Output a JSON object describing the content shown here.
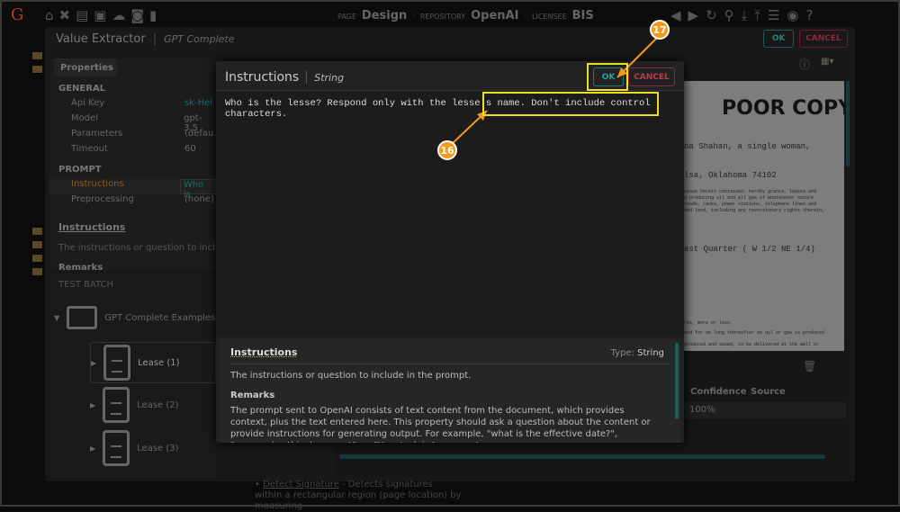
{
  "topbar": {
    "logo": "G",
    "page_label": "PAGE",
    "page": "Design",
    "repo_label": "REPOSITORY",
    "repo": "OpenAI",
    "licensee_label": "LICENSEE",
    "licensee": "BIS"
  },
  "panel": {
    "title": "Value Extractor",
    "subtitle": "GPT Complete",
    "ok": "OK",
    "cancel": "CANCEL"
  },
  "properties": {
    "tab": "Properties",
    "general": "GENERAL",
    "rows": [
      {
        "k": "Api Key",
        "v": "sk-Hel"
      },
      {
        "k": "Model",
        "v": "gpt-3.5"
      },
      {
        "k": "Parameters",
        "v": "(defau"
      },
      {
        "k": "Timeout",
        "v": "60"
      }
    ],
    "prompt": "PROMPT",
    "prompt_rows": [
      {
        "k": "Instructions",
        "v": "Who is"
      },
      {
        "k": "Preprocessing",
        "v": "(none)"
      }
    ],
    "help_title": "Instructions",
    "help_text": "The instructions or question to include in",
    "remarks": "Remarks"
  },
  "batch": {
    "title": "TEST BATCH",
    "folder": "GPT Complete Examples",
    "items": [
      "Lease (1)",
      "Lease (2)",
      "Lease (3)"
    ]
  },
  "modal": {
    "title": "Instructions",
    "type": "String",
    "ok": "OK",
    "cancel": "CANCEL",
    "value": "Who is the lesse? Respond only with the lesse's name. Don't include control characters.",
    "help_title": "Instructions",
    "type_label": "Type:",
    "type_value": "String",
    "help_desc": "The instructions or question to include in the prompt.",
    "remarks_title": "Remarks",
    "remarks": "The prompt sent to OpenAI consists of text content from the document, which provides context, plus the text entered here. This property should ask a question about the content or provide instructions for generating output. For example, \"what is the effective date?\", \"summarize this document\", or \"Your task is to generate a"
  },
  "document": {
    "stamp": "POOR COPY",
    "lines": [
      "na Shahan, a single woman,",
      "lsa, Oklahoma 74102",
      "Lease herein contained, hereby grants, leases and",
      "d producing oil and all gas of whatsoever nature",
      "roads, tanks, power stations, telephone lines and",
      "ded land, including any reversionary rights therein,",
      "ast Quarter ( W 1/2 NE 1/4)",
      "res, more or less.",
      "and for as long thereafter as oil or gas is produced",
      "produced and saved, to be delivered at the well or"
    ]
  },
  "results": {
    "headers": [
      "Confidence",
      "Source"
    ],
    "rows": [
      [
        "100%",
        ""
      ]
    ]
  },
  "below": {
    "link": "Detect Signature",
    "text": " - Detects signatures within a rectangular region (page location) by measuring"
  },
  "annotations": [
    "16",
    "17"
  ],
  "colors": {
    "accent": "#1d7a7a",
    "cancel": "#a02a3a",
    "annotation": "#f29a1c",
    "highlight": "#e8e020"
  }
}
